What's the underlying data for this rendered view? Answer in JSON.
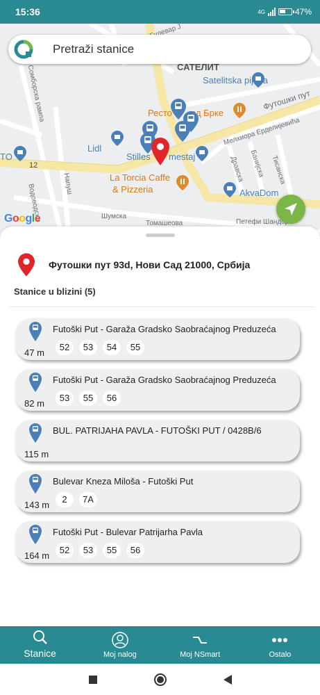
{
  "status_bar": {
    "time": "15:36",
    "network": "4G",
    "battery": "47%"
  },
  "search": {
    "placeholder": "Pretraži stanice"
  },
  "map": {
    "labels": {
      "satelit": "САТЕЛИТ",
      "satelitska_pijaca": "Satelitska pijaca",
      "restoran": "Ресто",
      "brke": "од Брке",
      "futoski_put_map": "Футошки пут",
      "melkiora": "Мелхиора Ерделијевића",
      "lidl": "Lidl",
      "stilles": "Stilles",
      "mestaj": "mestaj",
      "torcia_1": "La Torcia Caffe",
      "torcia_2": "& Pizzeria",
      "akvadom": "AkvaDom",
      "dravska": "Дравска",
      "banijska": "Банијска",
      "tisanska": "Тисанска",
      "road_12": "12",
      "sumska": "Шумска",
      "petefi": "Петефи Шандора",
      "tomaseova": "Томашеова",
      "sombor_rampa": "Сомборска рампа",
      "vodovodska": "Водоводска",
      "napuš": "Напуш",
      "to": "TO",
      "bulevar": "Булевар Ј"
    },
    "attribution": [
      "G",
      "o",
      "o",
      "g",
      "l",
      "e"
    ],
    "locate_button": "navigation-arrow"
  },
  "address": {
    "text": "Футошки пут 93d, Нови Сад 21000, Србија"
  },
  "nearby": {
    "title": "Stanice u blizini (5)"
  },
  "stations": [
    {
      "name": "Futoški Put - Garaža Gradsko Saobraćajnog Preduzeća",
      "distance": "47 m",
      "lines": [
        "52",
        "53",
        "54",
        "55"
      ]
    },
    {
      "name": "Futoški Put - Garaža Gradsko Saobraćajnog Preduzeća",
      "distance": "82 m",
      "lines": [
        "53",
        "55",
        "56"
      ]
    },
    {
      "name": "BUL. PATRIJAHA PAVLA - FUTOŠKI PUT / 0428B/6",
      "distance": "115 m",
      "lines": []
    },
    {
      "name": "Bulevar Kneza Miloša - Futoški Put",
      "distance": "143 m",
      "lines": [
        "2",
        "7A"
      ]
    },
    {
      "name": "Futoški Put - Bulevar Patrijarha Pavla",
      "distance": "164 m",
      "lines": [
        "52",
        "53",
        "55",
        "56"
      ]
    }
  ],
  "tabs": [
    {
      "label": "Stanice",
      "icon": "search-icon",
      "active": true
    },
    {
      "label": "Moj nalog",
      "icon": "user-icon",
      "active": false
    },
    {
      "label": "Moj NSmart",
      "icon": "nsmart-icon",
      "active": false
    },
    {
      "label": "Ostalo",
      "icon": "more-icon",
      "active": false
    }
  ],
  "colors": {
    "primary": "#2a8a93",
    "locate": "#7ab648",
    "pin": "#e0262b",
    "bus_pin": "#4a7fb8"
  }
}
